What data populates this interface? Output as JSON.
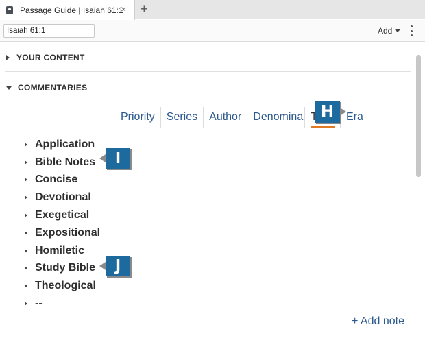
{
  "tab": {
    "title": "Passage Guide | Isaiah 61:1",
    "close_glyph": "×",
    "add_glyph": "+"
  },
  "toolbar": {
    "reference_value": "Isaiah 61:1",
    "add_label": "Add"
  },
  "sections": {
    "your_content": "YOUR CONTENT",
    "commentaries": "COMMENTARIES"
  },
  "sort_options": [
    {
      "label": "Priority",
      "active": false
    },
    {
      "label": "Series",
      "active": false
    },
    {
      "label": "Author",
      "active": false
    },
    {
      "label": "Denomina",
      "active": false
    },
    {
      "label": "Type",
      "active": true
    },
    {
      "label": "Era",
      "active": false
    }
  ],
  "types": [
    "Application",
    "Bible Notes",
    "Concise",
    "Devotional",
    "Exegetical",
    "Expositional",
    "Homiletic",
    "Study Bible",
    "Theological",
    "--"
  ],
  "add_note_label": "+ Add note",
  "callouts": {
    "h": "H",
    "i": "I",
    "j": "J"
  },
  "colors": {
    "accent_blue": "#2c5a8f",
    "callout_blue": "#1d6a9e",
    "active_underline": "#e07a24"
  },
  "icons": {
    "tab": "document-icon",
    "menu": "kebab-icon"
  }
}
